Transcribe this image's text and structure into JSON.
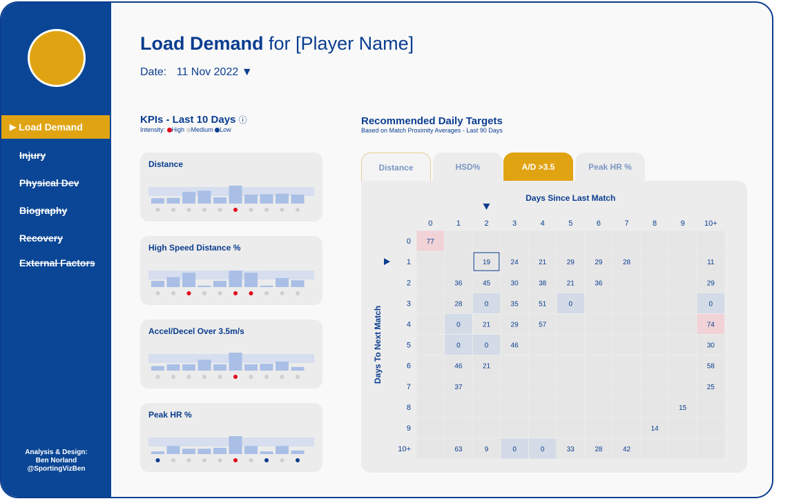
{
  "sidebar": {
    "items": [
      {
        "label": "Load Demand",
        "active": true
      },
      {
        "label": "Injury",
        "active": false
      },
      {
        "label": "Physical Dev",
        "active": false
      },
      {
        "label": "Biography",
        "active": false
      },
      {
        "label": "Recovery",
        "active": false
      },
      {
        "label": "External Factors",
        "active": false
      }
    ],
    "credit_line1": "Analysis & Design:",
    "credit_line2": "Ben Norland",
    "credit_line3": "@SportingVizBen"
  },
  "header": {
    "title_bold": "Load Demand",
    "title_rest": " for [Player Name]",
    "date_label": "Date:",
    "date_value": "11 Nov 2022 ▼"
  },
  "kpis": {
    "heading": "KPIs - Last 10 Days",
    "info_glyph": "ⓘ",
    "legend_prefix": "Intensity:",
    "legend_high": "High",
    "legend_medium": "Medium",
    "legend_low": "Low",
    "colors": {
      "high": "#e0061a",
      "medium": "#cfcfcf",
      "low": "#0a3d8f",
      "bar": "#a9bfe6",
      "band": "#d6deef"
    },
    "cards": [
      {
        "label": "Distance",
        "bars": [
          0.3,
          0.32,
          0.65,
          0.72,
          0.35,
          1.0,
          0.5,
          0.52,
          0.55,
          0.5
        ],
        "intensity": [
          "medium",
          "medium",
          "medium",
          "medium",
          "medium",
          "high",
          "medium",
          "medium",
          "medium",
          "medium"
        ]
      },
      {
        "label": "High Speed Distance %",
        "bars": [
          0.35,
          0.55,
          0.8,
          0.08,
          0.35,
          0.92,
          0.8,
          0.08,
          0.5,
          0.38
        ],
        "intensity": [
          "medium",
          "medium",
          "high",
          "medium",
          "medium",
          "high",
          "high",
          "medium",
          "medium",
          "medium"
        ]
      },
      {
        "label": "Accel/Decel Over 3.5m/s",
        "bars": [
          0.25,
          0.35,
          0.35,
          0.6,
          0.35,
          1.0,
          0.35,
          0.38,
          0.5,
          0.2
        ],
        "intensity": [
          "medium",
          "medium",
          "medium",
          "medium",
          "medium",
          "high",
          "medium",
          "medium",
          "medium",
          "medium"
        ]
      },
      {
        "label": "Peak HR %",
        "bars": [
          0.15,
          0.45,
          0.3,
          0.3,
          0.35,
          1.0,
          0.45,
          0.15,
          0.45,
          0.2
        ],
        "intensity": [
          "low",
          "medium",
          "medium",
          "medium",
          "medium",
          "high",
          "medium",
          "low",
          "medium",
          "low"
        ]
      }
    ]
  },
  "recommended": {
    "heading": "Recommended Daily Targets",
    "subheading": "Based on Match Proximity Averages - Last 90 Days",
    "tabs": [
      {
        "label": "Distance",
        "active": false
      },
      {
        "label": "HSD%",
        "active": false
      },
      {
        "label": "A/D >3.5",
        "active": true
      },
      {
        "label": "Peak HR %",
        "active": false
      }
    ]
  },
  "chart_data": {
    "type": "heatmap",
    "title": "Days Since Last Match",
    "xlabel": "Days Since Last Match",
    "ylabel": "Days To Next Match",
    "x_categories": [
      "0",
      "1",
      "2",
      "3",
      "4",
      "5",
      "6",
      "7",
      "8",
      "9",
      "10+"
    ],
    "y_categories": [
      "0",
      "1",
      "2",
      "3",
      "4",
      "5",
      "6",
      "7",
      "8",
      "9",
      "10+"
    ],
    "selected_column": "2",
    "selected_row": "1",
    "cells": [
      [
        "77",
        null,
        null,
        null,
        null,
        null,
        null,
        null,
        null,
        null,
        null
      ],
      [
        null,
        null,
        "19",
        "24",
        "21",
        "29",
        "29",
        "28",
        null,
        null,
        "11"
      ],
      [
        null,
        "36",
        "45",
        "30",
        "38",
        "21",
        "36",
        null,
        null,
        null,
        "29"
      ],
      [
        null,
        "28",
        "0",
        "35",
        "51",
        "0",
        null,
        null,
        null,
        null,
        "0"
      ],
      [
        null,
        "0",
        "21",
        "29",
        "57",
        null,
        null,
        null,
        null,
        null,
        "74"
      ],
      [
        null,
        "0",
        "0",
        "46",
        null,
        null,
        null,
        null,
        null,
        null,
        "30"
      ],
      [
        null,
        "46",
        "21",
        null,
        null,
        null,
        null,
        null,
        null,
        null,
        "58"
      ],
      [
        null,
        "37",
        null,
        null,
        null,
        null,
        null,
        null,
        null,
        null,
        "25"
      ],
      [
        null,
        null,
        null,
        null,
        null,
        null,
        null,
        null,
        null,
        "15",
        null
      ],
      [
        null,
        null,
        null,
        null,
        null,
        null,
        null,
        null,
        "14",
        null,
        null
      ],
      [
        null,
        "63",
        "9",
        "0",
        "0",
        "33",
        "28",
        "42",
        null,
        null,
        null
      ]
    ],
    "highlight": {
      "red": [
        [
          0,
          0
        ],
        [
          4,
          10
        ]
      ],
      "blue": [
        [
          3,
          2
        ],
        [
          3,
          5
        ],
        [
          3,
          10
        ],
        [
          4,
          1
        ],
        [
          5,
          1
        ],
        [
          5,
          2
        ],
        [
          10,
          3
        ],
        [
          10,
          4
        ]
      ],
      "boxed": [
        [
          1,
          2
        ]
      ]
    },
    "colors": {
      "red": "#f1d2d7",
      "blue": "#d3dbe6",
      "cell": "#e6e6e6",
      "text": "#0a3d8f"
    }
  }
}
